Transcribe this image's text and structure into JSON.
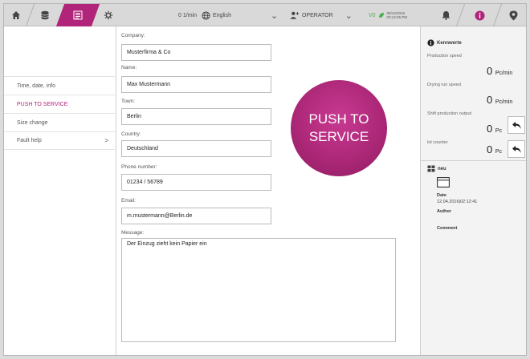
{
  "topbar": {
    "rate": "0 1/min",
    "language": "English",
    "user": "OPERATOR",
    "status_code": "V0",
    "date": "05/12/2016",
    "time": "03:12:25 PM",
    "accent_color": "#b0247a"
  },
  "sidebar": {
    "items": [
      {
        "label": "Time, date, info"
      },
      {
        "label": "PUSH TO SERVICE"
      },
      {
        "label": "Size change"
      },
      {
        "label": "Fault help",
        "arrow": ">"
      }
    ]
  },
  "form": {
    "company_label": "Company:",
    "company_value": "Musterfirma & Co",
    "name_label": "Name:",
    "name_value": "Max Mustermann",
    "town_label": "Town:",
    "town_value": "Berlin",
    "country_label": "Country:",
    "country_value": "Deutschland",
    "phone_label": "Phone number:",
    "phone_value": "01234 / 56789",
    "email_label": "Email:",
    "email_value": "m.mustermann@Berlin.de",
    "message_label": "Message:",
    "message_value": "Der Einzug zieht kein Papier ein"
  },
  "push_button": {
    "line1": "PUSH TO",
    "line2": "SERVICE"
  },
  "right_panel": {
    "title": "Kennwerte",
    "production_speed_label": "Production speed",
    "production_speed_value": "0",
    "production_speed_unit": "Pc/min",
    "drying_speed_label": "Drying run speed",
    "drying_speed_value": "0",
    "drying_speed_unit": "Pc/min",
    "shift_output_label": "Shift production output",
    "shift_output_value": "0",
    "shift_output_unit": "Pc",
    "lot_counter_label": "lot counter",
    "lot_counter_value": "0",
    "lot_counter_unit": "Pc",
    "log_title": "neu",
    "date_label": "Date",
    "date_value": "12.04.2016|02:12:41",
    "author_label": "Author",
    "comment_label": "Comment"
  }
}
